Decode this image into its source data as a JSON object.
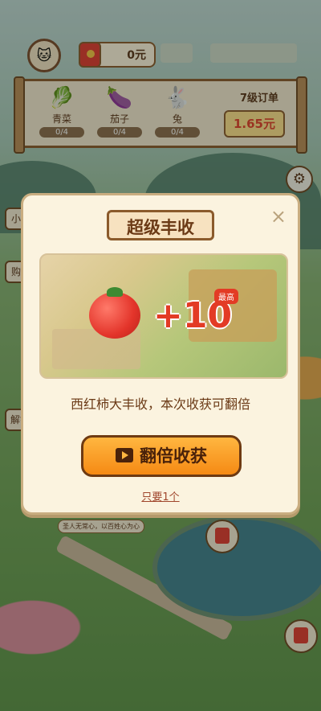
{
  "hud": {
    "avatar_icon": "cat-avatar-icon",
    "money_amount": "0元"
  },
  "order": {
    "items": [
      {
        "name": "青菜",
        "count": "0/4",
        "icon": "🥬"
      },
      {
        "name": "茄子",
        "count": "0/4",
        "icon": "🍆"
      },
      {
        "name": "兔",
        "count": "0/4",
        "icon": "🐇"
      }
    ],
    "title": "7级订单",
    "reward": "1.65元"
  },
  "side": {
    "btn_1": "小",
    "btn_2": "购",
    "btn_3": "解锁"
  },
  "modal": {
    "title": "超级丰收",
    "close": "×",
    "bonus": "+10",
    "badge": "最高",
    "description": "西红柿大丰收，本次收获可翻倍",
    "action_button": "翻倍收获",
    "secondary_link": "只要1个"
  },
  "scene": {
    "speech_bubble": "圣人无常心，以百姓心为心"
  },
  "colors": {
    "accent_orange": "#f58a14",
    "accent_red": "#e33b25",
    "brown": "#8b5a2b"
  }
}
